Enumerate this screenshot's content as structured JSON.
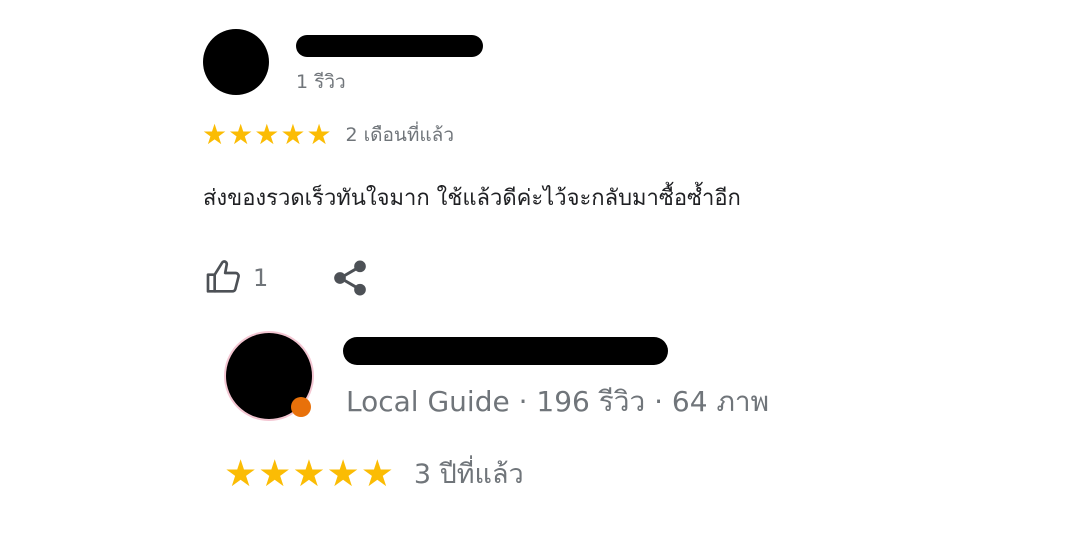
{
  "reviews": [
    {
      "meta": "1 รีวิว",
      "rating": 5,
      "time_ago": "2 เดือนที่แล้ว",
      "text": "ส่งของรวดเร็วทันใจมาก ใช้แล้วดีค่ะไว้จะกลับมาซื้อซ้ำอีก",
      "likes": "1",
      "icons": {
        "like": "thumbs-up-icon",
        "share": "share-icon"
      }
    },
    {
      "meta": "Local Guide · 196 รีวิว · 64 ภาพ",
      "rating": 5,
      "time_ago": "3 ปีที่แล้ว",
      "badge_icon": "local-guide-badge-icon"
    }
  ],
  "colors": {
    "star": "#fbbc04",
    "meta": "#70757a",
    "text": "#202124",
    "badge": "#e8710a"
  }
}
